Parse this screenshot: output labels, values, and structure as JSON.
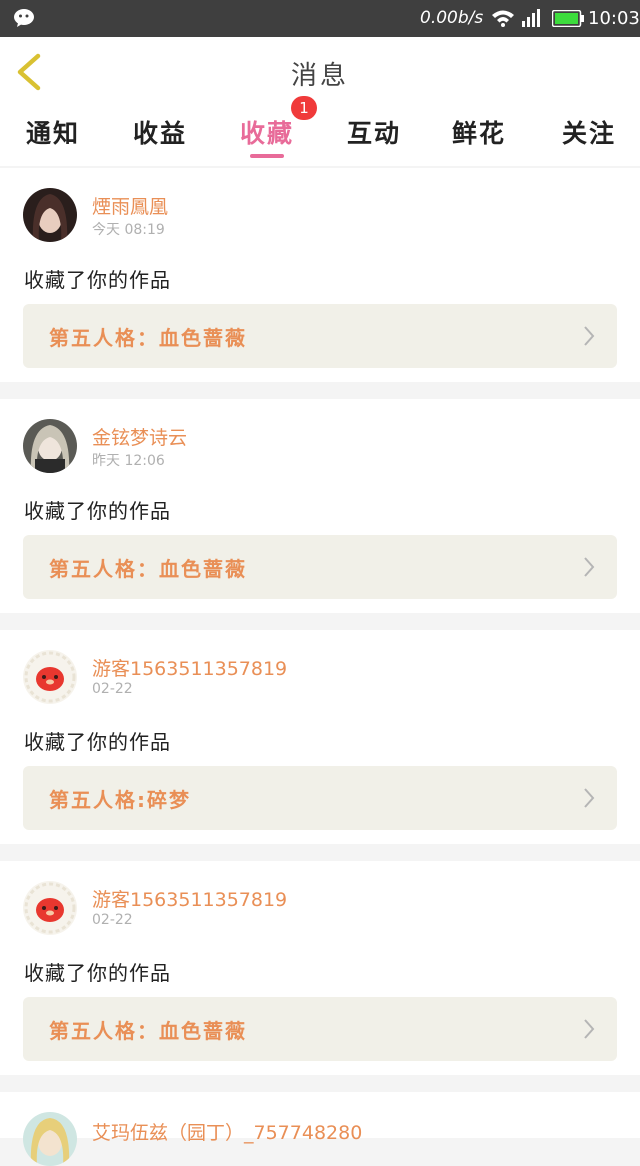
{
  "status_bar": {
    "net_speed": "0.00b/s",
    "time": "10:03",
    "icons": [
      "wechat-icon",
      "wifi-icon",
      "signal-icon",
      "battery-icon"
    ]
  },
  "header": {
    "title": "消息",
    "back_icon": "chevron-left-icon"
  },
  "tabs": [
    {
      "label": "通知"
    },
    {
      "label": "收益"
    },
    {
      "label": "收藏",
      "active": true,
      "badge": "1"
    },
    {
      "label": "互动"
    },
    {
      "label": "鲜花"
    },
    {
      "label": "关注"
    }
  ],
  "messages": [
    {
      "user": "煙雨鳳凰",
      "time": "今天 08:19",
      "action": "收藏了你的作品",
      "work": "第五人格：血色蔷薇"
    },
    {
      "user": "金铉梦诗云",
      "time": "昨天 12:06",
      "action": "收藏了你的作品",
      "work": "第五人格：血色蔷薇"
    },
    {
      "user": "游客1563511357819",
      "time": "02-22",
      "action": "收藏了你的作品",
      "work": "第五人格:碎梦"
    },
    {
      "user": "游客1563511357819",
      "time": "02-22",
      "action": "收藏了你的作品",
      "work": "第五人格：血色蔷薇"
    },
    {
      "user": "艾玛伍兹（园丁）_757748280",
      "time": "",
      "action": "",
      "work": ""
    }
  ],
  "colors": {
    "accent": "#e86b99",
    "username": "#e98f56",
    "badge": "#f03a3a",
    "status_bar": "#3f3f3f"
  }
}
